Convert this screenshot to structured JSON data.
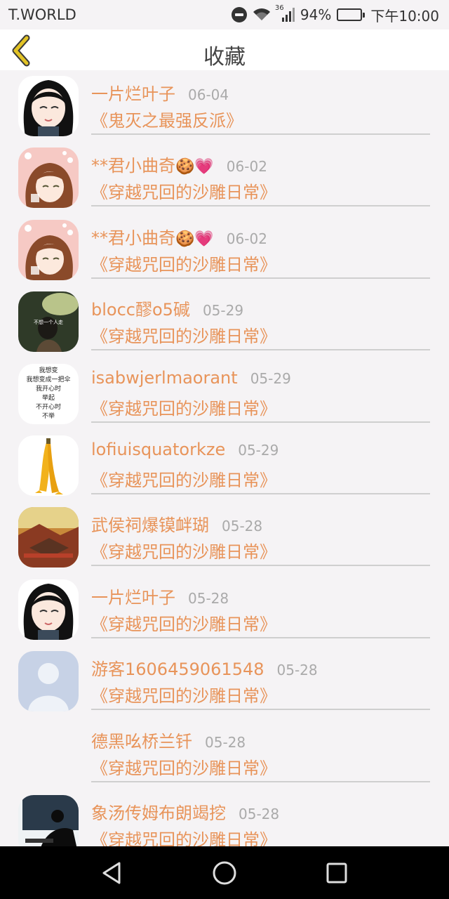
{
  "status_bar": {
    "carrier": "T.WORLD",
    "network": "36",
    "battery": "94%",
    "battery_level": 0.94,
    "time": "下午10:00"
  },
  "header": {
    "title": "收藏"
  },
  "items": [
    {
      "name": "一片烂叶子",
      "emoji": "",
      "date": "06-04",
      "book": "《鬼灭之最强反派》",
      "avatar": "anime-black-hair-avatar"
    },
    {
      "name": "**君小曲奇",
      "emoji": "🍪💗",
      "date": "06-02",
      "book": "《穿越咒回的沙雕日常》",
      "avatar": "anime-brown-hair-avatar"
    },
    {
      "name": "**君小曲奇",
      "emoji": "🍪💗",
      "date": "06-02",
      "book": "《穿越咒回的沙雕日常》",
      "avatar": "anime-brown-hair-avatar"
    },
    {
      "name": "blocc醪o5碱",
      "emoji": "",
      "date": "05-29",
      "book": "《穿越咒回的沙雕日常》",
      "avatar": "photo-woman-avatar"
    },
    {
      "name": "isabwjerlmaorant",
      "emoji": "",
      "date": "05-29",
      "book": "《穿越咒回的沙雕日常》",
      "avatar": "text-avatar"
    },
    {
      "name": "lofiuisquatorkze",
      "emoji": "",
      "date": "05-29",
      "book": "《穿越咒回的沙雕日常》",
      "avatar": "banana-avatar"
    },
    {
      "name": "武侯祠爆镆衅瑚",
      "emoji": "",
      "date": "05-28",
      "book": "《穿越咒回的沙雕日常》",
      "avatar": "palace-painting-avatar"
    },
    {
      "name": "一片烂叶子",
      "emoji": "",
      "date": "05-28",
      "book": "《穿越咒回的沙雕日常》",
      "avatar": "anime-black-hair-avatar"
    },
    {
      "name": "游客1606459061548",
      "emoji": "",
      "date": "05-28",
      "book": "《穿越咒回的沙雕日常》",
      "avatar": "default-user-avatar"
    },
    {
      "name": "德黑吆桥兰钎",
      "emoji": "",
      "date": "05-28",
      "book": "《穿越咒回的沙雕日常》",
      "avatar": "empty-avatar"
    },
    {
      "name": "象汤传姆布朗竭挖",
      "emoji": "",
      "date": "05-28",
      "book": "《穿越咒回的沙雕日常》",
      "avatar": "silhouette-avatar"
    }
  ],
  "text_avatar_lines": [
    "我想变",
    "我想变成一把伞",
    "我开心时",
    "举起",
    "不开心时",
    "不举"
  ],
  "photo_avatar_caption": "不想一个人走",
  "colors": {
    "accent": "#e8945a",
    "date": "#aaaaaa",
    "divider": "#cfcfcf",
    "back_arrow": "#e2c325"
  }
}
